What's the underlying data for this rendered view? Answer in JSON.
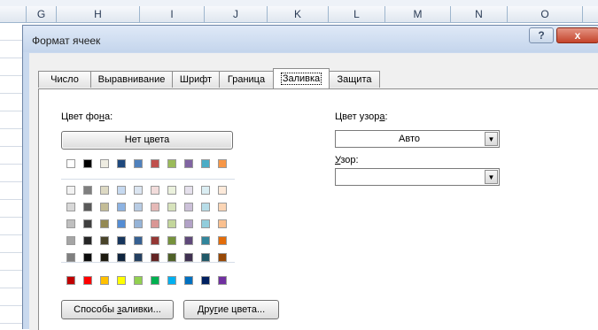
{
  "sheet": {
    "columns": [
      "G",
      "H",
      "I",
      "J",
      "K",
      "L",
      "M",
      "N",
      "O"
    ]
  },
  "dialog": {
    "title": "Формат ячеек",
    "help_symbol": "?",
    "close_symbol": "x",
    "tabs": [
      {
        "label": "Число",
        "active": false
      },
      {
        "label": "Выравнивание",
        "active": false
      },
      {
        "label": "Шрифт",
        "active": false
      },
      {
        "label": "Граница",
        "active": false
      },
      {
        "label": "Заливка",
        "active": true
      },
      {
        "label": "Защита",
        "active": false
      }
    ]
  },
  "fill": {
    "background_label_pre": "Цвет фо",
    "background_label_u": "н",
    "background_label_post": "а:",
    "no_color_label": "Нет цвета",
    "pattern_color_label_pre": "Цвет узор",
    "pattern_color_label_u": "а",
    "pattern_color_label_post": ":",
    "pattern_color_value": "Авто",
    "pattern_style_label_u": "У",
    "pattern_style_label_post": "зор:",
    "pattern_style_value": "",
    "fill_effects_pre": "Способы ",
    "fill_effects_u": "з",
    "fill_effects_post": "аливки...",
    "more_colors_pre": "Дру",
    "more_colors_u": "г",
    "more_colors_post": "ие цвета...",
    "palette": {
      "theme_top": [
        "#FFFFFF",
        "#000000",
        "#EEECE1",
        "#1F497D",
        "#4F81BD",
        "#C0504D",
        "#9BBB59",
        "#8064A2",
        "#4BACC6",
        "#F79646"
      ],
      "tints": [
        [
          "#F2F2F2",
          "#7F7F7F",
          "#DDD9C3",
          "#C6D9F0",
          "#DBE5F1",
          "#F2DCDB",
          "#EBF1DD",
          "#E5E0EC",
          "#DBEEF3",
          "#FDEADA"
        ],
        [
          "#D8D8D8",
          "#595959",
          "#C4BD97",
          "#8DB3E2",
          "#B8CCE4",
          "#E5B9B7",
          "#D7E3BC",
          "#CCC1D9",
          "#B7DDE8",
          "#FBD5B5"
        ],
        [
          "#BFBFBF",
          "#3F3F3F",
          "#938953",
          "#548DD4",
          "#95B3D7",
          "#D99694",
          "#C3D69B",
          "#B2A2C7",
          "#92CDDC",
          "#FAC08F"
        ],
        [
          "#A5A5A5",
          "#262626",
          "#494429",
          "#17365D",
          "#366092",
          "#953734",
          "#76923C",
          "#5F497A",
          "#31859B",
          "#E36C09"
        ],
        [
          "#7F7F7F",
          "#0C0C0C",
          "#1D1B10",
          "#0F243E",
          "#244061",
          "#632423",
          "#4F6128",
          "#3F3151",
          "#205867",
          "#974806"
        ]
      ],
      "standard": [
        "#C00000",
        "#FF0000",
        "#FFC000",
        "#FFFF00",
        "#92D050",
        "#00B050",
        "#00B0F0",
        "#0070C0",
        "#002060",
        "#7030A0"
      ]
    }
  }
}
